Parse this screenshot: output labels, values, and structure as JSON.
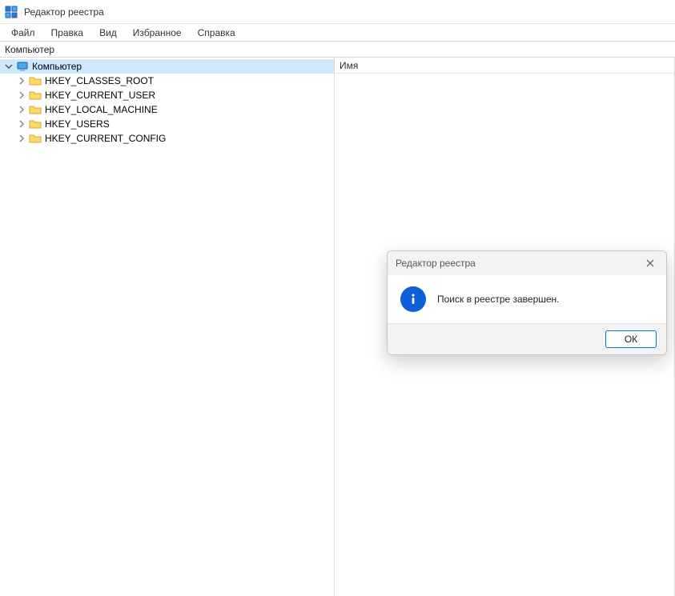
{
  "window": {
    "title": "Редактор реестра"
  },
  "menu": {
    "items": [
      "Файл",
      "Правка",
      "Вид",
      "Избранное",
      "Справка"
    ]
  },
  "addressbar": {
    "path": "Компьютер"
  },
  "tree": {
    "root": {
      "label": "Компьютер",
      "expanded": true
    },
    "hives": [
      "HKEY_CLASSES_ROOT",
      "HKEY_CURRENT_USER",
      "HKEY_LOCAL_MACHINE",
      "HKEY_USERS",
      "HKEY_CURRENT_CONFIG"
    ]
  },
  "list": {
    "columns": [
      "Имя"
    ]
  },
  "dialog": {
    "title": "Редактор реестра",
    "message": "Поиск в реестре завершен.",
    "ok": "ОК"
  }
}
